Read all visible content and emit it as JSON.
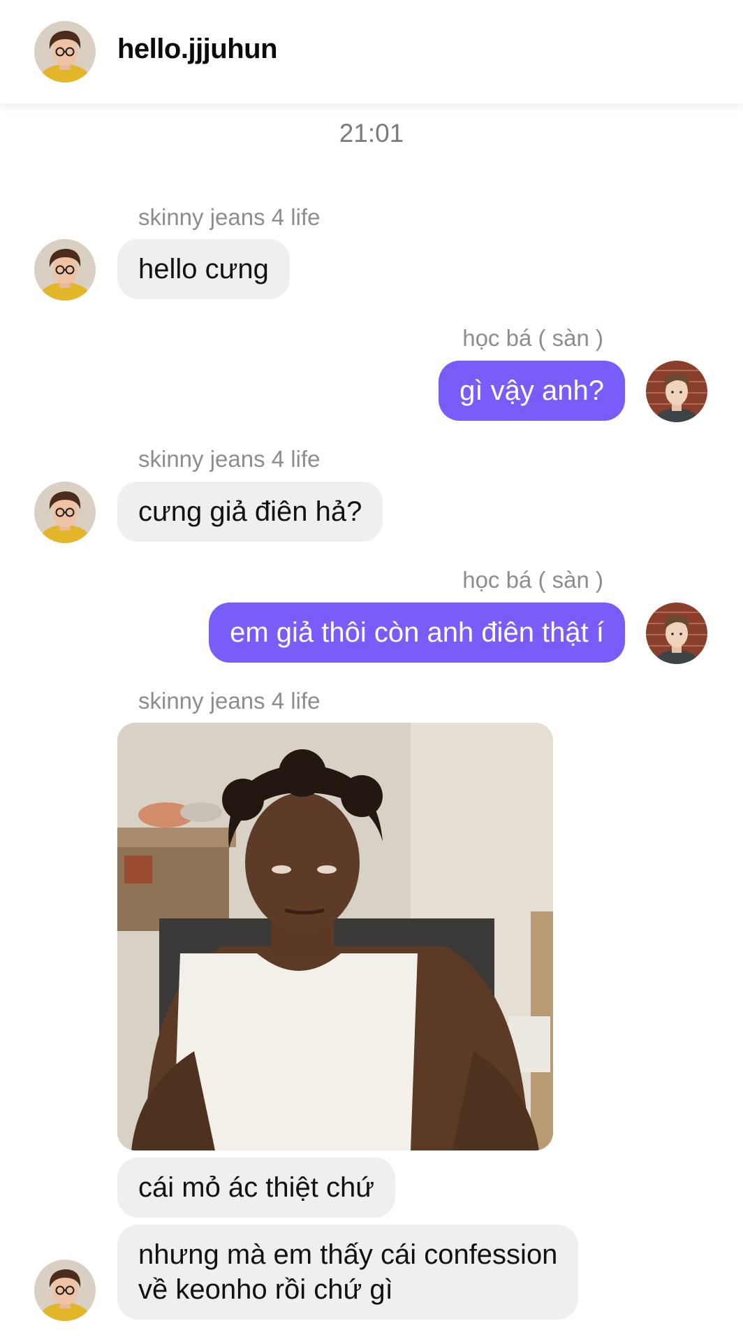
{
  "header": {
    "username": "hello.jjjuhun"
  },
  "timestamp": "21:01",
  "contacts": {
    "them": "skinny jeans 4 life",
    "me": "học bá ( sàn )"
  },
  "messages": [
    {
      "from": "them",
      "text": "hello cưng"
    },
    {
      "from": "me",
      "text": "gì vậy anh?"
    },
    {
      "from": "them",
      "text": "cưng giả điên hả?"
    },
    {
      "from": "me",
      "text": "em giả thôi còn anh điên thật í"
    },
    {
      "from": "them",
      "type": "image"
    },
    {
      "from": "them",
      "text": "cái mỏ ác thiệt chứ"
    },
    {
      "from": "them",
      "text_line1": "nhưng mà em thấy cái confession",
      "text_line2": "về keonho rồi chứ gì"
    }
  ],
  "colors": {
    "outgoing_bubble": "#7a5cf9",
    "incoming_bubble": "#efeff1",
    "sender_label": "#8d8d8d"
  }
}
